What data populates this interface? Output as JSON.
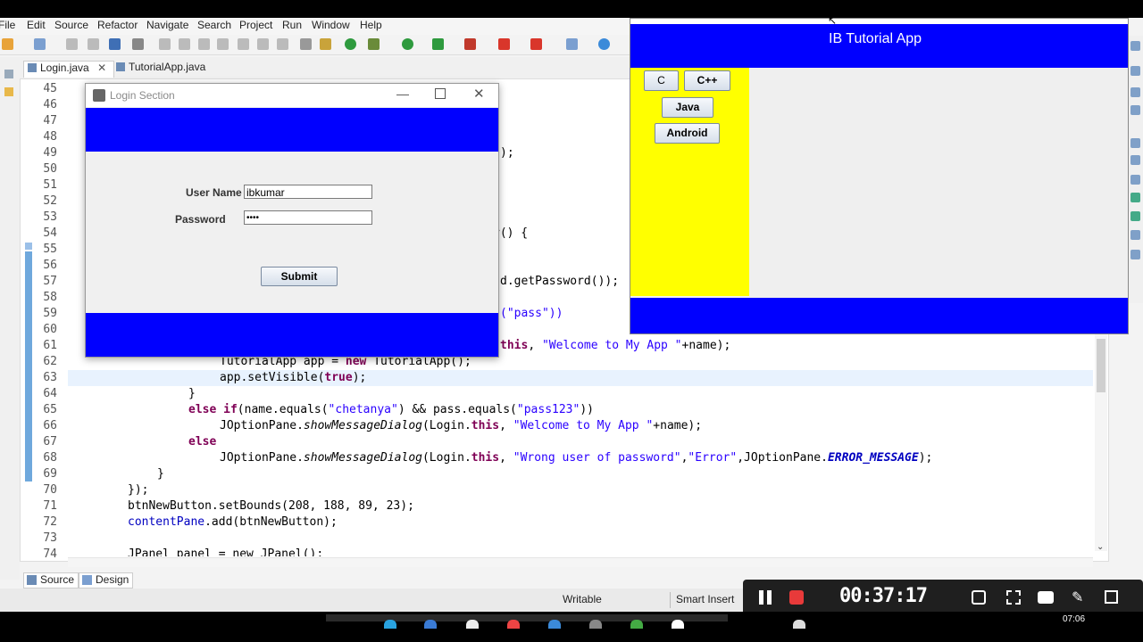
{
  "menu": [
    "File",
    "Edit",
    "Source",
    "Refactor",
    "Navigate",
    "Search",
    "Project",
    "Run",
    "Window",
    "Help"
  ],
  "tabs": [
    {
      "label": "Login.java"
    },
    {
      "label": "TutorialApp.java"
    }
  ],
  "line_numbers": [
    "45",
    "46",
    "47",
    "48",
    "49",
    "50",
    "51",
    "52",
    "53",
    "54",
    "55",
    "56",
    "57",
    "58",
    "59",
    "60",
    "61",
    "62",
    "63",
    "64",
    "65",
    "66",
    "67",
    "68",
    "69",
    "70",
    "71",
    "72",
    "73",
    "74"
  ],
  "code_fragments": {
    "l49": ");",
    "l54": "r() {",
    "l57a": "d.getPassword());",
    "l59a": "(\"pass\"))",
    "l61_kw": "this",
    "l61_str": "\"Welcome to My App \"",
    "l61_tail": "+name);",
    "l62_a": "TutorialApp app = ",
    "l62_kw": "new",
    "l62_b": " TutorialApp();",
    "l63_a": "app.setVisible(",
    "l63_kw": "true",
    "l63_b": ");",
    "l64": "}",
    "l65_kw1": "else",
    "l65_kw2": "if",
    "l65_a": "(name.equals(",
    "l65_str1": "\"chetanya\"",
    "l65_b": ") && pass.equals(",
    "l65_str2": "\"pass123\"",
    "l65_c": "))",
    "l66_a": "JOptionPane.",
    "l66_method": "showMessageDialog",
    "l66_b": "(Login.",
    "l66_kw": "this",
    "l66_c": ", ",
    "l66_str": "\"Welcome to My App \"",
    "l66_d": "+name);",
    "l67_kw": "else",
    "l68_a": "JOptionPane.",
    "l68_method": "showMessageDialog",
    "l68_b": "(Login.",
    "l68_kw": "this",
    "l68_c": ", ",
    "l68_str1": "\"Wrong user of password\"",
    "l68_d": ",",
    "l68_str2": "\"Error\"",
    "l68_e": ",JOptionPane.",
    "l68_const": "ERROR_MESSAGE",
    "l68_f": ");",
    "l69": "}",
    "l70": "});",
    "l71_a": "btnNewButton.setBounds(208, 188, 89, 23);",
    "l72_fld": "contentPane",
    "l72_a": ".add(btnNewButton);",
    "l74": "JPanel panel = new JPanel();"
  },
  "bottom_tabs": [
    "Source",
    "Design"
  ],
  "status": {
    "writable": "Writable",
    "insert": "Smart Insert"
  },
  "recorder": {
    "time": "00:37:17"
  },
  "taskbar": {
    "clock": "07:06"
  },
  "login_window": {
    "title": "Login Section",
    "username_label": "User Name",
    "username_value": "ibkumar",
    "password_label": "Password",
    "password_value": "••••",
    "submit_label": "Submit"
  },
  "tutorial_window": {
    "title": "IB Tutorial App",
    "buttons": [
      "C",
      "C++",
      "Java",
      "Android"
    ]
  },
  "colors": {
    "blue_panel": "#0000ff",
    "yellow_panel": "#ffff00",
    "keyword": "#7f0055",
    "string": "#2a00ff"
  }
}
